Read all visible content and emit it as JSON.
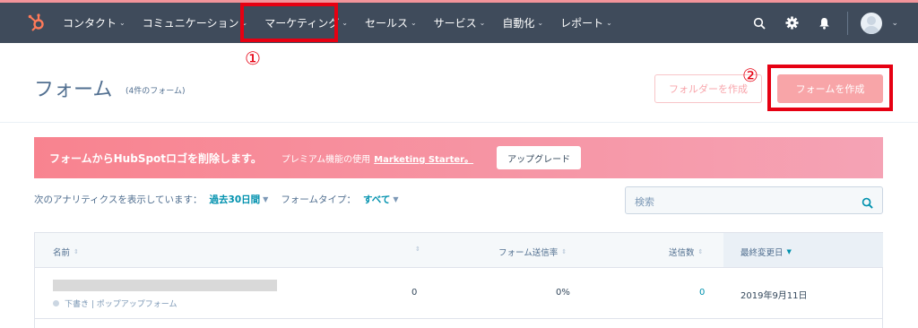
{
  "nav": {
    "items": [
      {
        "label": "コンタクト"
      },
      {
        "label": "コミュニケーション"
      },
      {
        "label": "マーケティング"
      },
      {
        "label": "セールス"
      },
      {
        "label": "サービス"
      },
      {
        "label": "自動化"
      },
      {
        "label": "レポート"
      }
    ],
    "icons": [
      "search-icon",
      "gear-icon",
      "bell-icon"
    ]
  },
  "annotations": {
    "n1": "①",
    "n2": "②"
  },
  "header": {
    "title": "フォーム",
    "subtitle": "(4件のフォーム)",
    "folder_button": "フォルダーを作成",
    "create_button": "フォームを作成"
  },
  "banner": {
    "title": "フォームからHubSpotロゴを削除します。",
    "text": "プレミアム機能の使用",
    "link": "Marketing Starter。",
    "button": "アップグレード"
  },
  "filters": {
    "label1": "次のアナリティクスを表示しています：",
    "value1": "過去30日間",
    "label2": "フォームタイプ：",
    "value2": "すべて"
  },
  "search": {
    "placeholder": "検索"
  },
  "table": {
    "headers": {
      "name": "名前",
      "rate": "フォーム送信率",
      "submissions": "送信数",
      "updated": "最終変更日"
    },
    "rows": [
      {
        "status": "下書き | ポップアップフォーム",
        "views": "0",
        "rate": "0%",
        "submissions": "0",
        "updated": "2019年9月11日"
      }
    ]
  },
  "colors": {
    "nav_bg": "#3f4b5b",
    "accent_red": "#e60012",
    "link": "#0091ae",
    "banner": "#f8838f"
  }
}
